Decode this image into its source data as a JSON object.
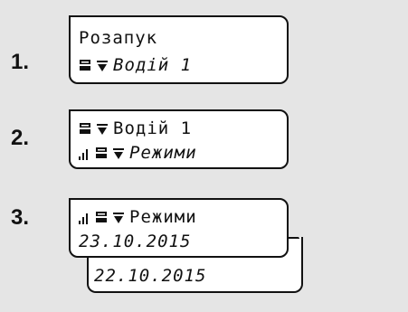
{
  "steps": [
    {
      "number": "1.",
      "line1": {
        "text": "Розапук"
      },
      "line2": {
        "icons": [
          "card-slot-icon",
          "down-arrow-icon"
        ],
        "text": "Водій 1"
      }
    },
    {
      "number": "2.",
      "line1": {
        "icons": [
          "card-slot-icon",
          "down-arrow-icon"
        ],
        "text": "Водій 1"
      },
      "line2": {
        "icons": [
          "signal-bars-icon",
          "card-slot-icon",
          "down-arrow-icon"
        ],
        "text": "Режими"
      }
    },
    {
      "number": "3.",
      "line1": {
        "icons": [
          "signal-bars-icon",
          "card-slot-icon",
          "down-arrow-icon"
        ],
        "text": "Режими"
      },
      "line2": {
        "text": "23.10.2015"
      },
      "back_line": {
        "text": "22.10.2015"
      }
    }
  ]
}
